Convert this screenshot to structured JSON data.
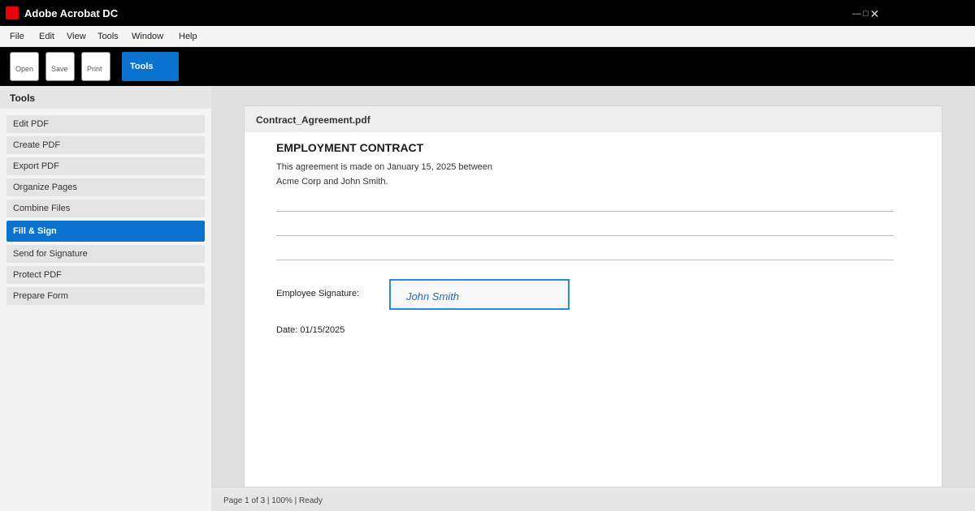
{
  "window": {
    "title": "Adobe Acrobat DC",
    "logo_icon": "acrobat-logo-icon",
    "logo_color": "#e8000b",
    "controls": {
      "minimize": "—",
      "maximize": "□",
      "close": "✕"
    }
  },
  "menu": {
    "items": [
      "File",
      "Edit",
      "View",
      "Tools",
      "Window",
      "Help"
    ]
  },
  "toolbar": {
    "open_label": "Open",
    "save_label": "Save",
    "print_label": "Print",
    "tools_label": "Tools",
    "accent": "#0a73d0"
  },
  "sidebar": {
    "title": "Tools",
    "items": [
      {
        "label": "Edit PDF",
        "active": false
      },
      {
        "label": "Create PDF",
        "active": false
      },
      {
        "label": "Export PDF",
        "active": false
      },
      {
        "label": "Organize Pages",
        "active": false
      },
      {
        "label": "Combine Files",
        "active": false
      },
      {
        "label": "Fill & Sign",
        "active": true
      },
      {
        "label": "Send for Signature",
        "active": false
      },
      {
        "label": "Protect PDF",
        "active": false
      },
      {
        "label": "Prepare Form",
        "active": false
      }
    ]
  },
  "document": {
    "filename": "Contract_Agreement.pdf",
    "heading": "EMPLOYMENT CONTRACT",
    "paragraph_lines": [
      "This agreement is made on January 15, 2025 between",
      "Acme Corp and John Smith."
    ],
    "signature_label": "Employee Signature:",
    "signature_value": "John Smith",
    "date_line": "Date: 01/15/2025"
  },
  "status": {
    "text": "Page 1 of 3 | 100% | Ready"
  }
}
